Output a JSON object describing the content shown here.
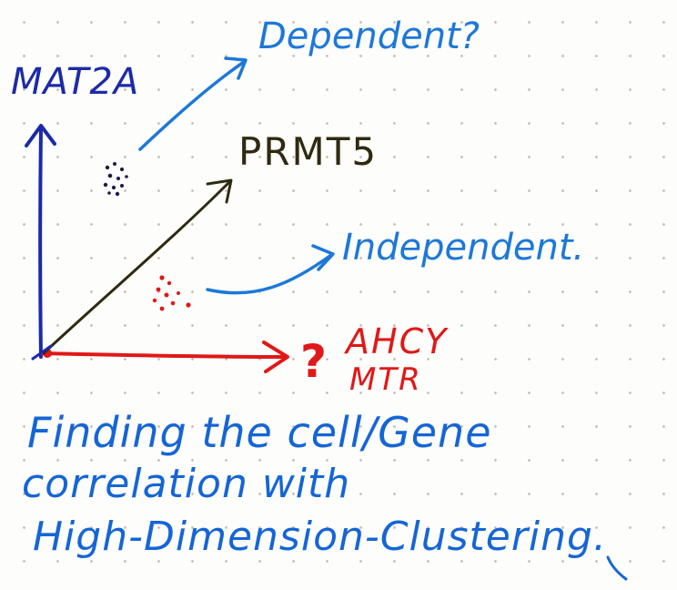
{
  "labels": {
    "y_axis_gene": "MAT2A",
    "diagonal_gene": "PRMT5",
    "x_axis_genes": [
      "AHCY",
      "MTR"
    ],
    "x_axis_question": "?",
    "dependent": "Dependent?",
    "independent": "Independent."
  },
  "caption": {
    "lines": [
      "Finding the cell/Gene",
      "correlation with",
      "High-Dimension-Clustering."
    ]
  },
  "colors": {
    "mat2a_axis": "#1c2aa8",
    "prmt5_axis": "#2f2a10",
    "ahcy_axis": "#e01818",
    "annotation_blue": "#1d78d8",
    "cluster_dark": "#1b1b4a",
    "cluster_red": "#e01818",
    "caption_blue": "#1565d6"
  }
}
